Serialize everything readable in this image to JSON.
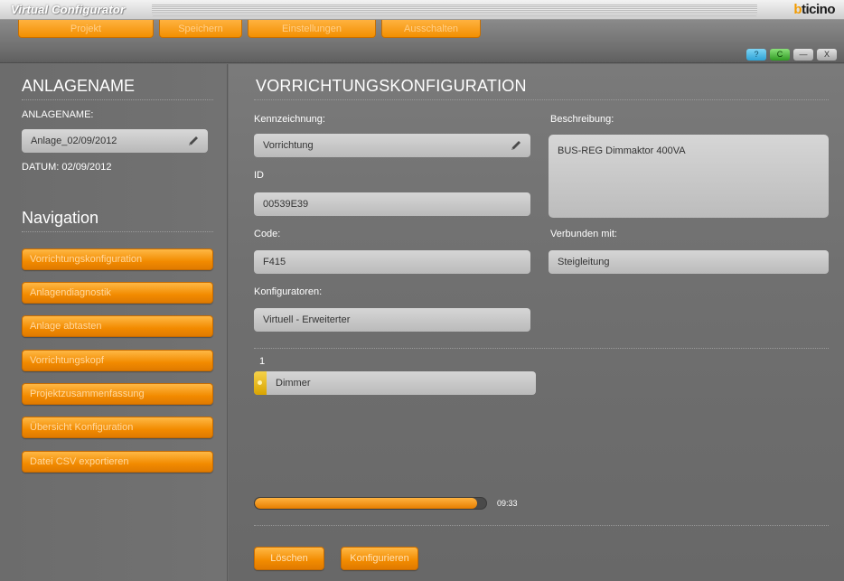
{
  "app": {
    "title": "Virtual Configurator",
    "brand_b": "b",
    "brand_rest": "ticino"
  },
  "menu": [
    "Projekt",
    "Speichern",
    "Einstellungen",
    "Ausschalten"
  ],
  "window_buttons": {
    "help": "?",
    "connect": "C",
    "minimize": "—",
    "close": "X"
  },
  "sidebar": {
    "section_title": "ANLAGENAME",
    "name_label": "ANLAGENAME:",
    "name_value": "Anlage_02/09/2012",
    "date_label": "DATUM: 02/09/2012",
    "nav_title": "Navigation",
    "nav_items": [
      "Vorrichtungskonfiguration",
      "Anlagendiagnostik",
      "Anlage abtasten",
      "Vorrichtungskopf",
      "Projektzusammenfassung",
      "Übersicht Konfiguration",
      "Datei CSV exportieren"
    ]
  },
  "main": {
    "title": "VORRICHTUNGSKONFIGURATION",
    "kennzeichnung_label": "Kennzeichnung:",
    "kennzeichnung_value": "Vorrichtung",
    "id_label": "ID",
    "id_value": "00539E39",
    "code_label": "Code:",
    "code_value": "F415",
    "konfiguratoren_label": "Konfiguratoren:",
    "konfiguratoren_value": "Virtuell - Erweiterter",
    "beschreibung_label": "Beschreibung:",
    "beschreibung_value": "BUS-REG Dimmaktor 400VA",
    "verbunden_label": "Verbunden mit:",
    "verbunden_value": "Steigleitung",
    "channel_number": "1",
    "channel_name": "Dimmer",
    "progress_time": "09:33",
    "progress_fraction": 0.96,
    "delete_button": "Löschen",
    "configure_button": "Konfigurieren"
  }
}
